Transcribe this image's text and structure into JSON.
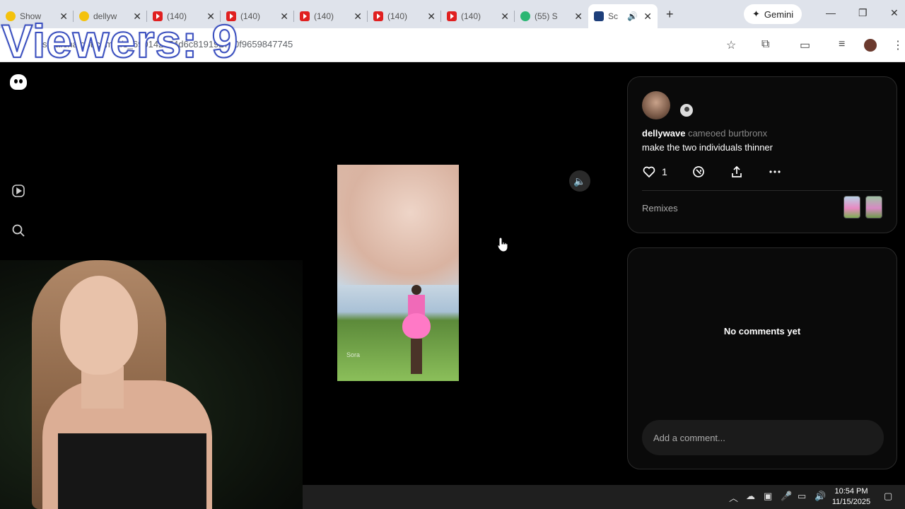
{
  "overlay": {
    "viewers": "Viewers: 9"
  },
  "browser": {
    "tabs": [
      {
        "label": "Show",
        "icon": "yellow-smiley"
      },
      {
        "label": "dellyw",
        "icon": "yellow-smiley"
      },
      {
        "label": "(140)",
        "icon": "youtube"
      },
      {
        "label": "(140)",
        "icon": "youtube"
      },
      {
        "label": "(140)",
        "icon": "youtube"
      },
      {
        "label": "(140)",
        "icon": "youtube"
      },
      {
        "label": "(140)",
        "icon": "youtube"
      },
      {
        "label": "(55) S",
        "icon": "green-app"
      },
      {
        "label": "Sc",
        "icon": "sora"
      }
    ],
    "gemini_label": "Gemini",
    "url": "sora.chatgpt.com/p/s_690142c74d6c819192760f9659847745"
  },
  "video": {
    "watermark": "Sora"
  },
  "post": {
    "author": "dellywave",
    "credit_text": "cameoed",
    "cameo_user": "burtbronx",
    "prompt": "make the two individuals thinner",
    "like_count": "1",
    "remixes_label": "Remixes"
  },
  "comments": {
    "empty_text": "No comments yet",
    "input_placeholder": "Add a comment..."
  },
  "taskbar": {
    "time": "10:54 PM",
    "date": "11/15/2025"
  }
}
